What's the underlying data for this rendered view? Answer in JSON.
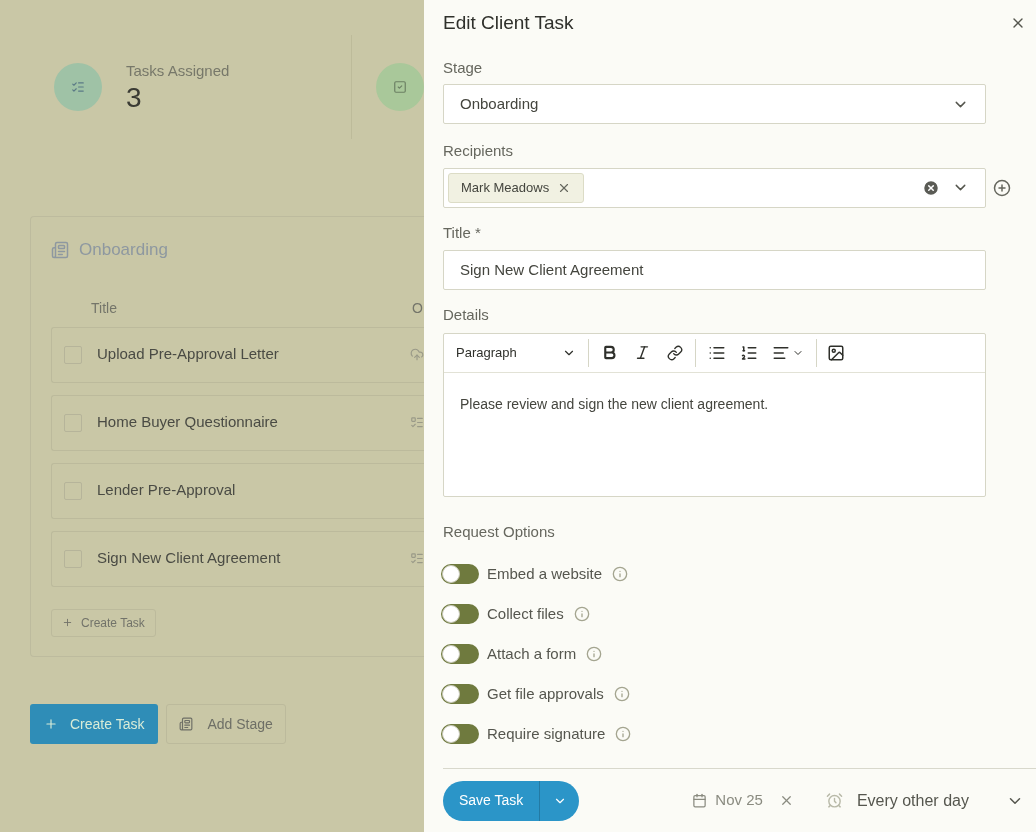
{
  "stats": [
    {
      "label": "Tasks Assigned",
      "value": "3"
    }
  ],
  "stage_card": {
    "title": "Onboarding",
    "column_1": "Title",
    "column_2": "O",
    "tasks": [
      {
        "title": "Upload Pre-Approval Letter",
        "checked": false,
        "kind": "upload"
      },
      {
        "title": "Home Buyer Questionnaire",
        "checked": false,
        "kind": "list"
      },
      {
        "title": "Lender Pre-Approval",
        "checked": false,
        "kind": "none"
      },
      {
        "title": "Sign New Client Agreement",
        "checked": false,
        "kind": "list"
      }
    ],
    "create_task": "Create Task"
  },
  "actions": [
    "Create Task",
    "Add Stage"
  ],
  "panel": {
    "title": "Edit Client Task",
    "stage": {
      "label": "Stage",
      "value": "Onboarding"
    },
    "recipients": {
      "label": "Recipients",
      "chips": [
        "Mark Meadows"
      ]
    },
    "task_title": {
      "label": "Title *",
      "value": "Sign New Client Agreement"
    },
    "details": {
      "label": "Details",
      "block_style": "Paragraph",
      "text": "Please review and sign the new client agreement."
    },
    "options_label": "Request Options",
    "options": [
      {
        "label": "Embed a website",
        "on": false
      },
      {
        "label": "Collect files",
        "on": false
      },
      {
        "label": "Attach a form",
        "on": false
      },
      {
        "label": "Get file approvals",
        "on": false
      },
      {
        "label": "Require signature",
        "on": false
      }
    ],
    "save": "Save Task",
    "due": "Nov 25",
    "repeat": "Every other day"
  }
}
